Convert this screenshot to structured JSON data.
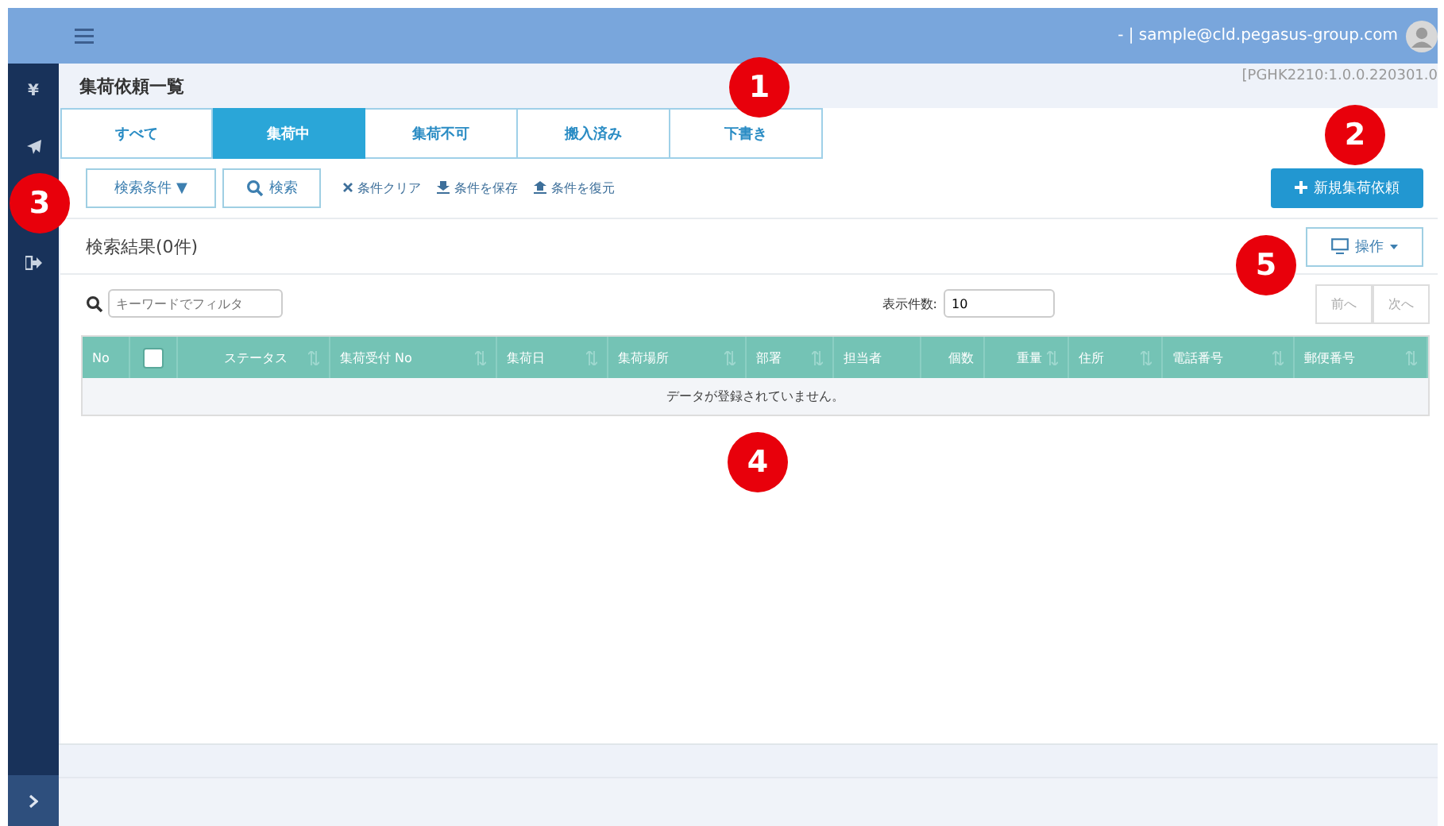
{
  "topbar": {
    "user": "- | sample@cld.pegasus-group.com"
  },
  "sidebar": {
    "items": [
      {
        "kind": "text",
        "label": "¥"
      },
      {
        "kind": "plane"
      },
      {
        "kind": "exit"
      }
    ]
  },
  "page": {
    "title": "集荷依頼一覧",
    "version": "[PGHK2210:1.0.0.220301.0"
  },
  "tabs": [
    {
      "label": "すべて",
      "selected": false
    },
    {
      "label": "集荷中",
      "selected": true
    },
    {
      "label": "集荷不可",
      "selected": false
    },
    {
      "label": "搬入済み",
      "selected": false
    },
    {
      "label": "下書き",
      "selected": false
    }
  ],
  "toolbar": {
    "conditions_button": "検索条件 ▼",
    "search_button": "検索",
    "links": [
      {
        "kind": "clear",
        "label": "条件クリア"
      },
      {
        "kind": "save",
        "label": "条件を保存"
      },
      {
        "kind": "restore",
        "label": "条件を復元"
      }
    ],
    "new_button": "新規集荷依頼"
  },
  "results": {
    "title": "検索結果(0件)",
    "operation_button": "操作"
  },
  "filter": {
    "placeholder": "キーワードでフィルタ",
    "page_size_label": "表示件数:",
    "page_size": "10",
    "prev": "前へ",
    "next": "次へ"
  },
  "table": {
    "columns": [
      {
        "label": "No",
        "kind": "text",
        "sortable": false
      },
      {
        "kind": "checkbox",
        "checked": false
      },
      {
        "label": "ステータス",
        "kind": "text",
        "sortable": true
      },
      {
        "label": "集荷受付 No",
        "kind": "text",
        "sortable": true
      },
      {
        "label": "集荷日",
        "kind": "text",
        "sortable": true
      },
      {
        "label": "集荷場所",
        "kind": "text",
        "sortable": true
      },
      {
        "label": "部署",
        "kind": "text",
        "sortable": true
      },
      {
        "label": "担当者",
        "kind": "text",
        "sortable": false
      },
      {
        "label": "個数",
        "kind": "text",
        "sortable": false
      },
      {
        "label": "重量",
        "kind": "text",
        "sortable": true
      },
      {
        "label": "住所",
        "kind": "text",
        "sortable": true
      },
      {
        "label": "電話番号",
        "kind": "text",
        "sortable": true
      },
      {
        "label": "郵便番号",
        "kind": "text",
        "sortable": true
      }
    ],
    "empty_message": "データが登録されていません。"
  },
  "callouts": [
    "1",
    "2",
    "3",
    "4",
    "5"
  ]
}
